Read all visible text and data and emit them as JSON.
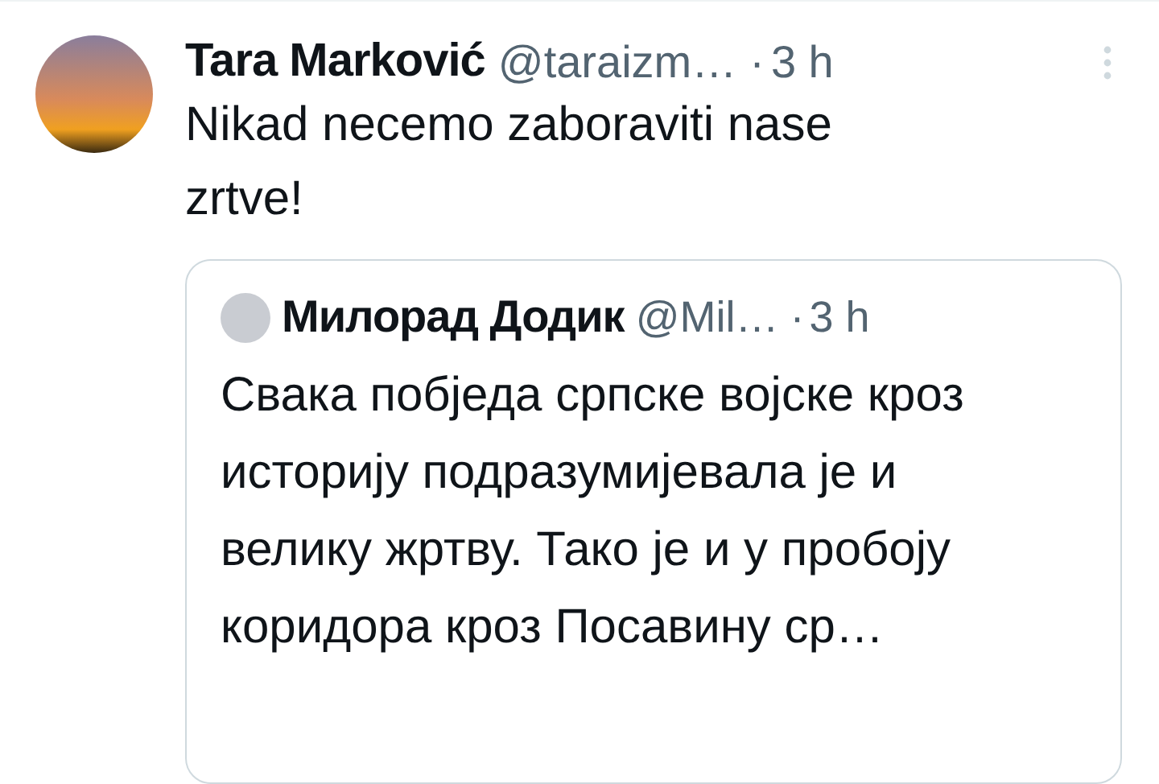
{
  "tweet": {
    "author_name": "Tara Marković",
    "handle": "@taraizm…",
    "separator": "·",
    "time": "3 h",
    "text": "Nikad necemo zaboraviti nase zrtve!",
    "quoted_tweet": {
      "author_name": "Милорад Додик",
      "handle": "@Mil…",
      "separator": "·",
      "time": "3 h",
      "text": "Свака побједа српске војске кроз историју подразумијевала је и велику жртву. Тако је и у пробоју коридора кроз Посавину ср…"
    }
  }
}
